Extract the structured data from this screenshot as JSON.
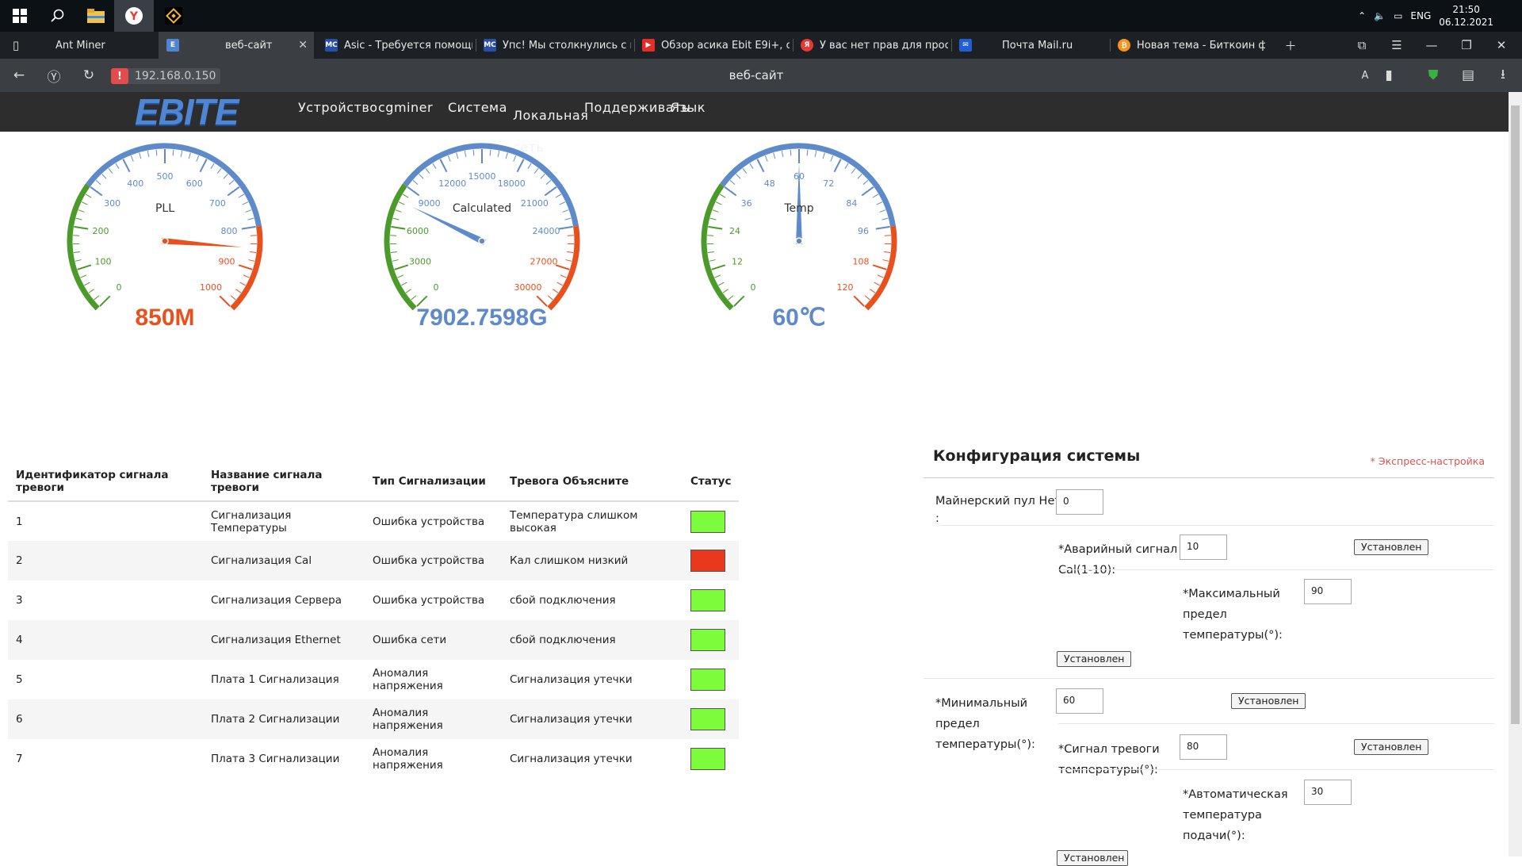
{
  "taskbar": {
    "tray": {
      "lang": "ENG",
      "time": "21:50",
      "date": "06.12.2021"
    }
  },
  "tabs": [
    {
      "label": "Ant Miner",
      "favicon": "page-icon"
    },
    {
      "label": "веб-сайт",
      "favicon": "ebit-icon"
    },
    {
      "label": "Asic - Требуется помощь",
      "favicon": "mc-icon"
    },
    {
      "label": "Упс! Мы столкнулись с не",
      "favicon": "mc-icon"
    },
    {
      "label": "Обзор асика Ebit E9i+, отз",
      "favicon": "youtube-icon"
    },
    {
      "label": "У вас нет прав для просмо",
      "favicon": "yandex-icon"
    },
    {
      "label": "Почта Mail.ru",
      "favicon": "mail-icon"
    },
    {
      "label": "Новая тема - Биткоин фор",
      "favicon": "bitcoin-icon"
    }
  ],
  "address": {
    "url": "192.168.0.150",
    "title": "веб-сайт"
  },
  "site": {
    "logo": "EBITE",
    "menu": [
      "Устройство",
      "cgminer",
      "Система",
      "Локальная сеть",
      "Поддерживать",
      "Язык"
    ]
  },
  "gauges": [
    {
      "title": "PLL",
      "value": "850M",
      "needle": 850,
      "min": 0,
      "max": 1000,
      "ticks": [
        "0",
        "100",
        "200",
        "300",
        "400",
        "500",
        "600",
        "700",
        "800",
        "900",
        "1000"
      ],
      "color": "#e8501e"
    },
    {
      "title": "Calculated",
      "value": "7902.7598G",
      "needle": 7902.7598,
      "min": 0,
      "max": 30000,
      "ticks": [
        "0",
        "3000",
        "6000",
        "9000",
        "12000",
        "15000",
        "18000",
        "21000",
        "24000",
        "27000",
        "30000"
      ],
      "color": "#5f8ac9"
    },
    {
      "title": "Temp",
      "value": "60℃",
      "needle": 60,
      "min": 0,
      "max": 120,
      "ticks": [
        "0",
        "12",
        "24",
        "36",
        "48",
        "60",
        "72",
        "84",
        "96",
        "108",
        "120"
      ],
      "color": "#5f8ac9"
    }
  ],
  "alarm_table": {
    "headers": [
      "Идентификатор сигнала тревоги",
      "Название сигнала тревоги",
      "Тип Сигнализации",
      "Тревога Объясните",
      "Статус"
    ],
    "rows": [
      {
        "id": "1",
        "name": "Сигнализация Температуры",
        "type": "Ошибка устройства",
        "explain": "Температура слишком высокая",
        "status": "#7dfc3c"
      },
      {
        "id": "2",
        "name": "Сигнализация Cal",
        "type": "Ошибка устройства",
        "explain": "Кал слишком низкий",
        "status": "#e8381e"
      },
      {
        "id": "3",
        "name": "Сигнализация Сервера",
        "type": "Ошибка устройства",
        "explain": "сбой подключения",
        "status": "#7dfc3c"
      },
      {
        "id": "4",
        "name": "Сигнализация Ethernet",
        "type": "Ошибка сети",
        "explain": "сбой подключения",
        "status": "#7dfc3c"
      },
      {
        "id": "5",
        "name": "Плата 1 Сигнализация",
        "type": "Аномалия напряжения",
        "explain": "Сигнализация утечки",
        "status": "#7dfc3c"
      },
      {
        "id": "6",
        "name": "Плата 2 Сигнализации",
        "type": "Аномалия напряжения",
        "explain": "Сигнализация утечки",
        "status": "#7dfc3c"
      },
      {
        "id": "7",
        "name": "Плата 3 Сигнализации",
        "type": "Аномалия напряжения",
        "explain": "Сигнализация утечки",
        "status": "#7dfc3c"
      }
    ]
  },
  "config": {
    "title": "Конфигурация системы",
    "express": "* Экспресс-настройка",
    "pool_label": "Майнерский пул Нет",
    "pool_colon": ":",
    "pool_value": "0",
    "cal_label_1": "*Аварийный сигнал",
    "cal_label_2": "Cal(1-10):",
    "cal_value": "10",
    "max_label_1": "*Максимальный",
    "max_label_2": "предел",
    "max_label_3": "температуры(°):",
    "max_value": "90",
    "min_label_1": "*Минимальный",
    "min_label_2": "предел",
    "min_label_3": "температуры(°):",
    "min_value": "60",
    "alarm_label_1": "*Сигнал тревоги",
    "alarm_label_2": "температуры(°):",
    "alarm_value": "80",
    "auto_label_1": "*Автоматическая",
    "auto_label_2": "температура",
    "auto_label_3": "подачи(°):",
    "auto_value": "30",
    "set_button": "Установлен"
  }
}
